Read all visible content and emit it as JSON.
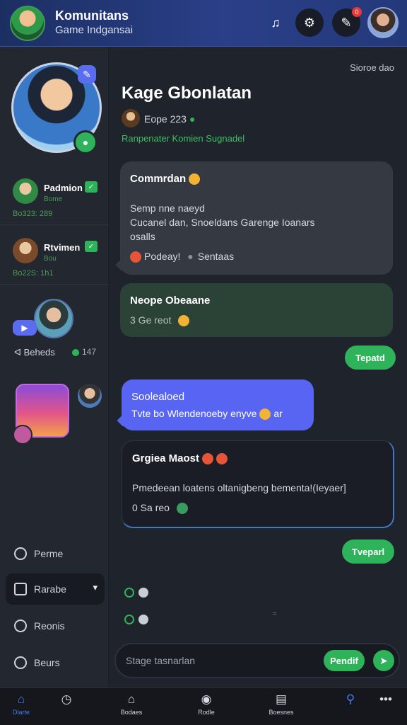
{
  "header": {
    "title": "Komunitans",
    "subtitle": "Game Indgansai",
    "icons": [
      "music-note-icon",
      "gear-icon",
      "pencil-icon",
      "user-avatar"
    ],
    "notification_badge": "0"
  },
  "sidebar": {
    "contacts": [
      {
        "name": "Padmion",
        "sub": "Bome",
        "meta": "Bo323: 289"
      },
      {
        "name": "Rtvimen",
        "sub": "Bou",
        "meta": "Bo22S: 1h1"
      }
    ],
    "beheds": {
      "label": "Beheds",
      "count": "147"
    },
    "nav": [
      {
        "label": "Perme",
        "icon": "chat-icon"
      },
      {
        "label": "Rarabe",
        "icon": "chat-alt-icon",
        "active": true
      },
      {
        "label": "Reonis",
        "icon": "settings-icon"
      },
      {
        "label": "Beurs",
        "icon": "clock-icon"
      }
    ]
  },
  "chat": {
    "status_top": "Sioroe dao",
    "title": "Kage Gbonlatan",
    "meta": "Eope 223",
    "subtitle": "Ranpenater Komien Sugnadel",
    "messages": [
      {
        "title": "Commrdan",
        "line1": "Semp nne naeyd",
        "line2": "Cucanel dan, Snoeldans Garenge Ioanars",
        "line3": "osalls",
        "footer_left": "Podeay!",
        "footer_right": "Sentaas"
      },
      {
        "title": "Neope Obeaane",
        "footer": "3 Ge reot"
      },
      {
        "pill": "Tepatd"
      },
      {
        "title": "Soolealoed",
        "text": "Tvte bo Wlendenoeby enyve",
        "suffix": "ar"
      },
      {
        "title": "Grgiea Maost",
        "text": "Pmedeean loatens oltanigbeng bementa!(Ieyaer]",
        "footer": "0 Sa reo"
      },
      {
        "pill": "Tveparl"
      }
    ],
    "composer": {
      "placeholder": "Stage tasnarlan",
      "send_label": "Pendif"
    }
  },
  "bottom_nav": [
    {
      "label": "Dlarte",
      "icon": "home-icon",
      "active": true
    },
    {
      "label": "",
      "icon": "clock-icon"
    },
    {
      "label": "Bodaes",
      "icon": "house-icon"
    },
    {
      "label": "Rodle",
      "icon": "gamepad-icon"
    },
    {
      "label": "Boesnes",
      "icon": "notebook-icon"
    },
    {
      "label": "",
      "icon": "search-icon"
    },
    {
      "label": "",
      "icon": "more-icon"
    }
  ]
}
